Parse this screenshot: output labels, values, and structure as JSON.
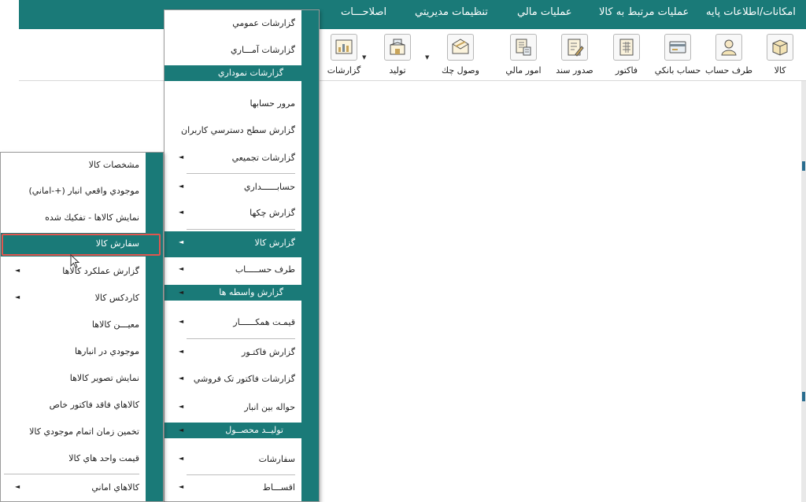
{
  "menubar": {
    "items": [
      "امکانات/اطلاعات پایه",
      "عملیات مرتبط به کالا",
      "عملیات مالي",
      "تنظیمات مدیریتي",
      "اصلاحـــات"
    ]
  },
  "toolbar": {
    "items": [
      {
        "label": "کالا",
        "icon": "box-icon"
      },
      {
        "label": "طرف حساب",
        "icon": "person-icon"
      },
      {
        "label": "حساب بانکي",
        "icon": "bank-card-icon"
      },
      {
        "label": "فاکتور",
        "icon": "invoice-icon"
      },
      {
        "label": "صدور سند",
        "icon": "document-edit-icon"
      },
      {
        "label": "امور مالي",
        "icon": "finance-icon"
      },
      {
        "label": "وصول چك",
        "icon": "cheque-envelope-icon"
      },
      {
        "label": "تولید",
        "icon": "production-icon"
      },
      {
        "label": "گزارشات",
        "icon": "report-chart-icon"
      }
    ]
  },
  "reports_menu": {
    "items": [
      {
        "label": "گزارشات عمومي"
      },
      {
        "label": "گزارشات آمـــاري"
      },
      {
        "label": "گزارشات نموداري"
      },
      {
        "label": "مرور حسابها"
      },
      {
        "label": "گزارش سطح دسترسي کاربران"
      },
      {
        "label": "گزارشات تجمیعي"
      },
      {
        "label": "حسابــــــداري"
      },
      {
        "label": "گزارش چکها"
      },
      {
        "label": "گزارش کالا"
      },
      {
        "label": "طرف حســـــاب"
      },
      {
        "label": "گزارش واسطه ها"
      },
      {
        "label": "قیمـت همکــــــار"
      },
      {
        "label": "گزارش فاکتـور"
      },
      {
        "label": "گزارشات فاکتور تک فروشي"
      },
      {
        "label": "حواله بین انبار"
      },
      {
        "label": "تولیــد محصــول"
      },
      {
        "label": "سفارشات"
      },
      {
        "label": "اقســـاط"
      }
    ]
  },
  "goods_menu": {
    "items": [
      {
        "label": "مشخصات کالا"
      },
      {
        "label": "موجودي واقعي انبار (+-اماني)"
      },
      {
        "label": "نمايش کالاها - تفکیك شده"
      },
      {
        "label": "سفارش کالا"
      },
      {
        "label": "گزارش عملکرد کالاها"
      },
      {
        "label": "کاردکس کالا"
      },
      {
        "label": "معیـــن کالاها"
      },
      {
        "label": "موجودي در انبارها"
      },
      {
        "label": "نمایش تصویر کالاها"
      },
      {
        "label": "کالاهاي فاقد فاکتور خاص"
      },
      {
        "label": "تخمین زمان اتمام موجودي کالا"
      },
      {
        "label": "قیمت واحد هاي کالا"
      },
      {
        "label": "کالاهاي اماني"
      }
    ]
  },
  "colors": {
    "accent": "#1a7a78",
    "focus_outline": "#e0564f"
  }
}
